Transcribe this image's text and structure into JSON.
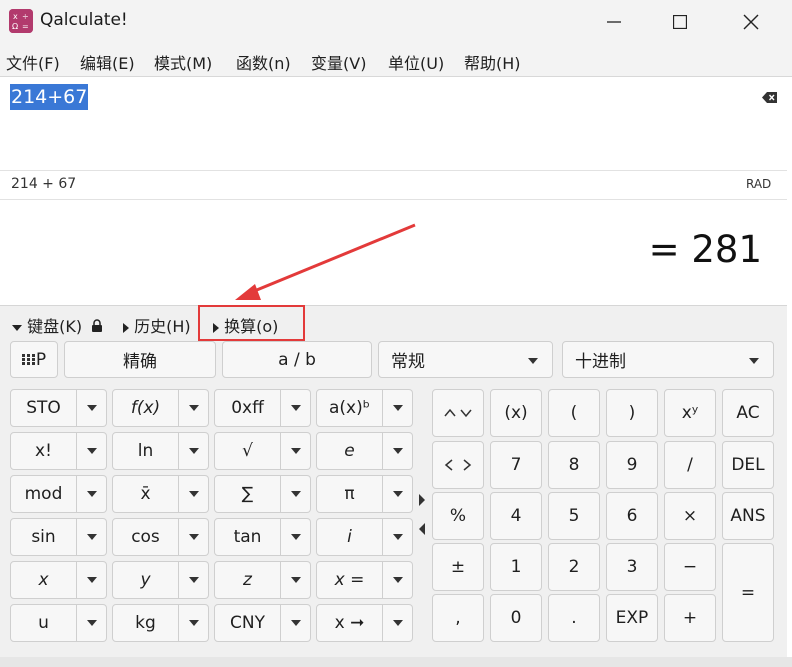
{
  "window": {
    "title": "Qalculate!",
    "icon_glyph": "x÷\nΩ=",
    "minimize_icon": "minimize-icon",
    "maximize_icon": "maximize-icon",
    "close_icon": "close-icon"
  },
  "menu": [
    "文件(F)",
    "编辑(E)",
    "模式(M)",
    "函数(n)",
    "变量(V)",
    "单位(U)",
    "帮助(H)"
  ],
  "expression": "214+67",
  "parsed_expression": "214 + 67",
  "angle_unit": "RAD",
  "result": "= 281",
  "expanders": {
    "keyboard": "键盘(K)",
    "history": "历史(H)",
    "conversion": "换算(o)"
  },
  "toolbar": {
    "keypad_toggle": "P",
    "precision": "精确",
    "fraction": "a / b",
    "display_mode": "常规",
    "base": "十进制"
  },
  "function_keys": [
    [
      "STO",
      "f(x)",
      "0xff",
      "a(x)ᵇ"
    ],
    [
      "x!",
      "ln",
      "√",
      "e"
    ],
    [
      "mod",
      "x̄",
      "∑",
      "π"
    ],
    [
      "sin",
      "cos",
      "tan",
      "i"
    ],
    [
      "x",
      "y",
      "z",
      "x ="
    ],
    [
      "u",
      "kg",
      "CNY",
      "x ➞"
    ]
  ],
  "numpad": {
    "row1": [
      "(x)",
      "(",
      ")",
      "xʸ",
      "AC"
    ],
    "row2": [
      "7",
      "8",
      "9",
      "/",
      "DEL"
    ],
    "row3": [
      "%",
      "4",
      "5",
      "6",
      "×",
      "ANS"
    ],
    "row4": [
      "±",
      "1",
      "2",
      "3",
      "−"
    ],
    "row5": [
      ",",
      "0",
      ".",
      "EXP",
      "+"
    ],
    "equals": "="
  },
  "accent_colors": {
    "selection": "#3a78d6",
    "annotation": "#e33a3a"
  }
}
